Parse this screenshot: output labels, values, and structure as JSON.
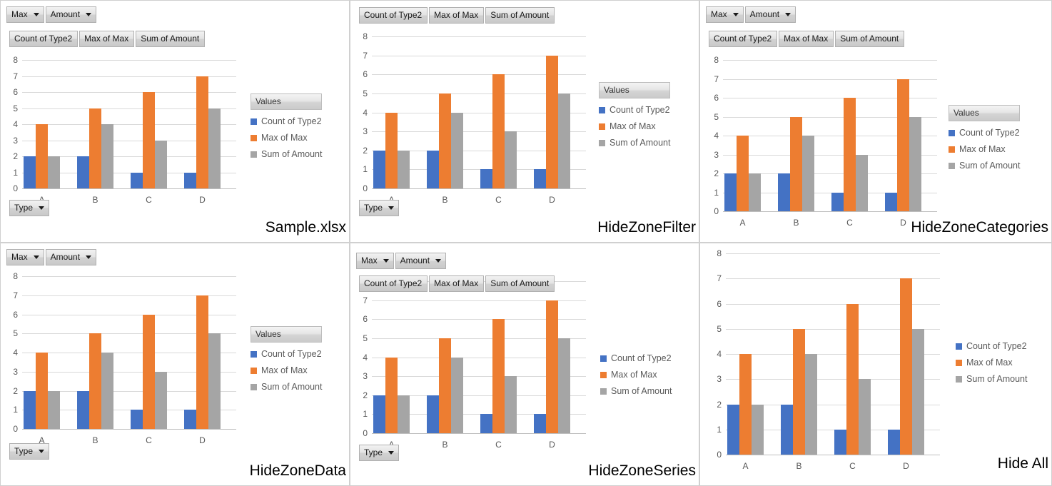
{
  "common": {
    "filter_buttons": [
      {
        "label": "Max",
        "caret": true
      },
      {
        "label": "Amount",
        "caret": true
      }
    ],
    "series_buttons": [
      {
        "label": "Count of Type2"
      },
      {
        "label": "Max of Max"
      },
      {
        "label": "Sum of Amount"
      }
    ],
    "axis_button": {
      "label": "Type",
      "caret": true
    },
    "legend_title": "Values",
    "colors": {
      "count_of_type2": "#4472C4",
      "max_of_max": "#ED7D31",
      "sum_of_amount": "#A5A5A5",
      "gridline": "#D9D9D9",
      "tick_text": "#595959"
    }
  },
  "chart_data": {
    "type": "bar",
    "title": "",
    "xlabel": "",
    "ylabel": "",
    "categories": [
      "A",
      "B",
      "C",
      "D"
    ],
    "ylim": [
      0,
      8
    ],
    "yticks": [
      0,
      1,
      2,
      3,
      4,
      5,
      6,
      7,
      8
    ],
    "grid": true,
    "legend_position": "right",
    "legend_title": "Values",
    "series": [
      {
        "name": "Count of Type2",
        "color": "#4472C4",
        "values": [
          2,
          2,
          1,
          1
        ]
      },
      {
        "name": "Max of Max",
        "color": "#ED7D31",
        "values": [
          4,
          5,
          6,
          7
        ]
      },
      {
        "name": "Sum of Amount",
        "color": "#A5A5A5",
        "values": [
          2,
          4,
          3,
          5
        ]
      }
    ]
  },
  "panels": [
    {
      "id": "sample",
      "caption": "Sample.xlsx",
      "show_filter_buttons": true,
      "show_series_buttons": true,
      "show_axis_button": true,
      "show_legend_title": true
    },
    {
      "id": "hide-zone-filter",
      "caption": "HideZoneFilter",
      "show_filter_buttons": false,
      "show_series_buttons": true,
      "show_axis_button": true,
      "show_legend_title": true
    },
    {
      "id": "hide-zone-categories",
      "caption": "HideZoneCategories",
      "show_filter_buttons": true,
      "show_series_buttons": true,
      "show_axis_button": false,
      "show_legend_title": true
    },
    {
      "id": "hide-zone-data",
      "caption": "HideZoneData",
      "show_filter_buttons": true,
      "show_series_buttons": false,
      "show_axis_button": true,
      "show_legend_title": true
    },
    {
      "id": "hide-zone-series",
      "caption": "HideZoneSeries",
      "show_filter_buttons": true,
      "show_series_buttons": true,
      "show_axis_button": true,
      "show_legend_title": false
    },
    {
      "id": "hide-all",
      "caption": "Hide All",
      "show_filter_buttons": false,
      "show_series_buttons": false,
      "show_axis_button": false,
      "show_legend_title": false
    }
  ]
}
